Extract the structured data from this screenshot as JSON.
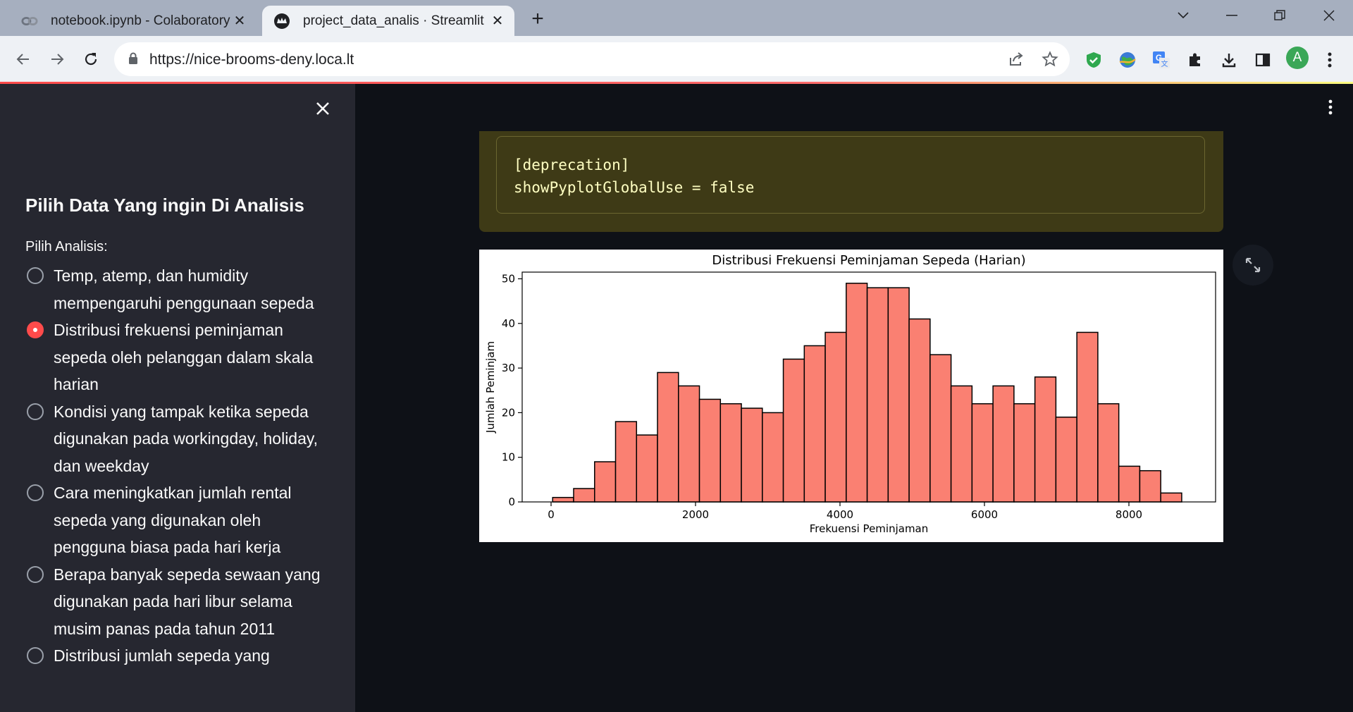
{
  "browser": {
    "tabs": [
      {
        "title": "notebook.ipynb - Colaboratory",
        "icon": "colab-icon",
        "active": false
      },
      {
        "title": "project_data_analis · Streamlit",
        "icon": "streamlit-crown-icon",
        "active": true
      }
    ],
    "url": "https://nice-brooms-deny.loca.lt",
    "profile_initial": "A",
    "accent": "#ff4b4b"
  },
  "sidebar": {
    "heading": "Pilih Data Yang ingin Di Analisis",
    "radio_label": "Pilih Analisis:",
    "options": [
      {
        "label": "Temp, atemp, dan humidity mempengaruhi penggunaan sepeda",
        "checked": false
      },
      {
        "label": "Distribusi frekuensi peminjaman sepeda oleh pelanggan dalam skala harian",
        "checked": true
      },
      {
        "label": "Kondisi yang tampak ketika sepeda digunakan pada workingday, holiday, dan weekday",
        "checked": false
      },
      {
        "label": "Cara meningkatkan jumlah rental sepeda yang digunakan oleh pengguna biasa pada hari kerja",
        "checked": false
      },
      {
        "label": "Berapa banyak sepeda sewaan yang digunakan pada hari libur selama musim panas pada tahun 2011",
        "checked": false
      },
      {
        "label": "Distribusi jumlah sepeda yang",
        "checked": false
      }
    ]
  },
  "main": {
    "warning_lines": [
      "[deprecation]",
      "showPyplotGlobalUse = false"
    ]
  },
  "chart_data": {
    "type": "bar",
    "title": "Distribusi Frekuensi Peminjaman Sepeda (Harian)",
    "xlabel": "Frekuensi Peminjaman",
    "ylabel": "Jumlah Peminjam",
    "xlim": [
      -400,
      9200
    ],
    "ylim": [
      0,
      51.5
    ],
    "xticks": [
      0,
      2000,
      4000,
      6000,
      8000
    ],
    "yticks": [
      0,
      10,
      20,
      30,
      40,
      50
    ],
    "bin_start": 22,
    "bin_width": 290.3,
    "values": [
      1,
      3,
      9,
      18,
      15,
      29,
      26,
      23,
      22,
      21,
      20,
      32,
      35,
      38,
      49,
      48,
      48,
      41,
      33,
      26,
      22,
      26,
      22,
      28,
      19,
      38,
      22,
      8,
      7,
      2
    ],
    "bar_color": "#fa8072",
    "edge_color": "#000000"
  }
}
